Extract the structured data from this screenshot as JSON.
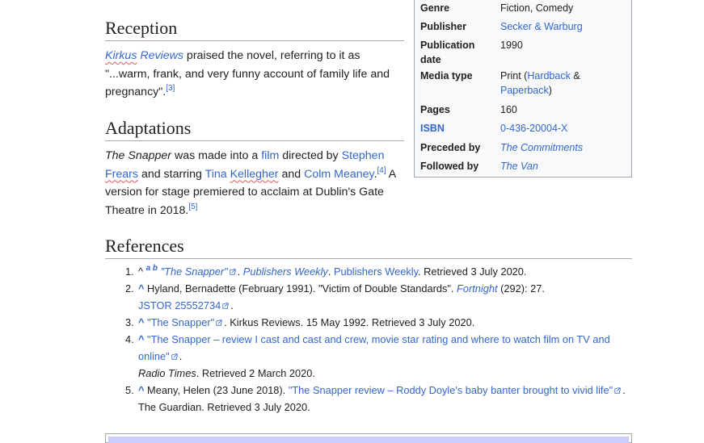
{
  "infobox": {
    "rows": [
      {
        "label": "Genre",
        "value": "Fiction, Comedy"
      },
      {
        "label": "Publisher",
        "value": "Secker & Warburg"
      },
      {
        "label": "Publication date",
        "value": "1990"
      },
      {
        "label": "Media type",
        "value_prefix": "Print (",
        "value_link1": "Hardback",
        "value_mid": " &",
        "value_link2": "Paperback",
        "value_suffix": ")"
      },
      {
        "label": "Pages",
        "value": "160"
      },
      {
        "label": "ISBN",
        "value": "0-436-20004-X"
      },
      {
        "label": "Preceded by",
        "value": "The Commitments"
      },
      {
        "label": "Followed by",
        "value": "The Van"
      }
    ]
  },
  "reception": {
    "heading": "Reception",
    "link_kirkus": "Kirkus",
    "link_reviews": " Reviews",
    "text1": " praised the novel, referring to it as \"...warm, frank, and very funny account of family life and pregnancy\".",
    "cite": "[3]"
  },
  "adaptations": {
    "heading": "Adaptations",
    "title": "The Snapper",
    "text1": " was made into a ",
    "link_film": "film",
    "text2": " directed by ",
    "link_stephen": "Stephen",
    "link_frears": "Frears",
    "text3": " and starring ",
    "link_tina": "Tina ",
    "link_kellegher": "Kellegher",
    "text4": " and ",
    "link_colm": "Colm Meaney",
    "text5": ".",
    "cite1": "[4]",
    "text6": " A version for stage premiered to acclaim at Dublin's Gate Theatre in 2018.",
    "cite2": "[5]"
  },
  "references": {
    "heading": "References",
    "items": [
      {
        "num": "1.",
        "caret": "^",
        "ab": "a b",
        "link": "\"The Snapper\"",
        "pub": "Publishers Weekly",
        "pub2": "Publishers Weekly",
        "rest": ". Retrieved 3 July 2020."
      },
      {
        "num": "2.",
        "caret": "^",
        "text": " Hyland, Bernadette (February 1991). \"Victim of Double Standards\". ",
        "journal": "Fortnight",
        "rest": " (292): 27.",
        "jstor": "JSTOR 25552734"
      },
      {
        "num": "3.",
        "caret": "^",
        "link": "\"The Snapper\"",
        "rest": ". Kirkus Reviews. 15 May 1992. Retrieved 3 July 2020."
      },
      {
        "num": "4.",
        "caret": "^",
        "link": "\"The Snapper – review I cast and cast and crew, movie star rating and where to watch film on TV and online\"",
        "work": "Radio Times",
        "rest": ". Retrieved 2 March 2020."
      },
      {
        "num": "5.",
        "caret": "^",
        "text": " Meany, Helen (23 June 2018). ",
        "link": "\"The Snapper review – Roddy Doyle's baby banter brought to vivid life\"",
        "rest": "The Guardian. Retrieved 3 July 2020."
      }
    ]
  }
}
